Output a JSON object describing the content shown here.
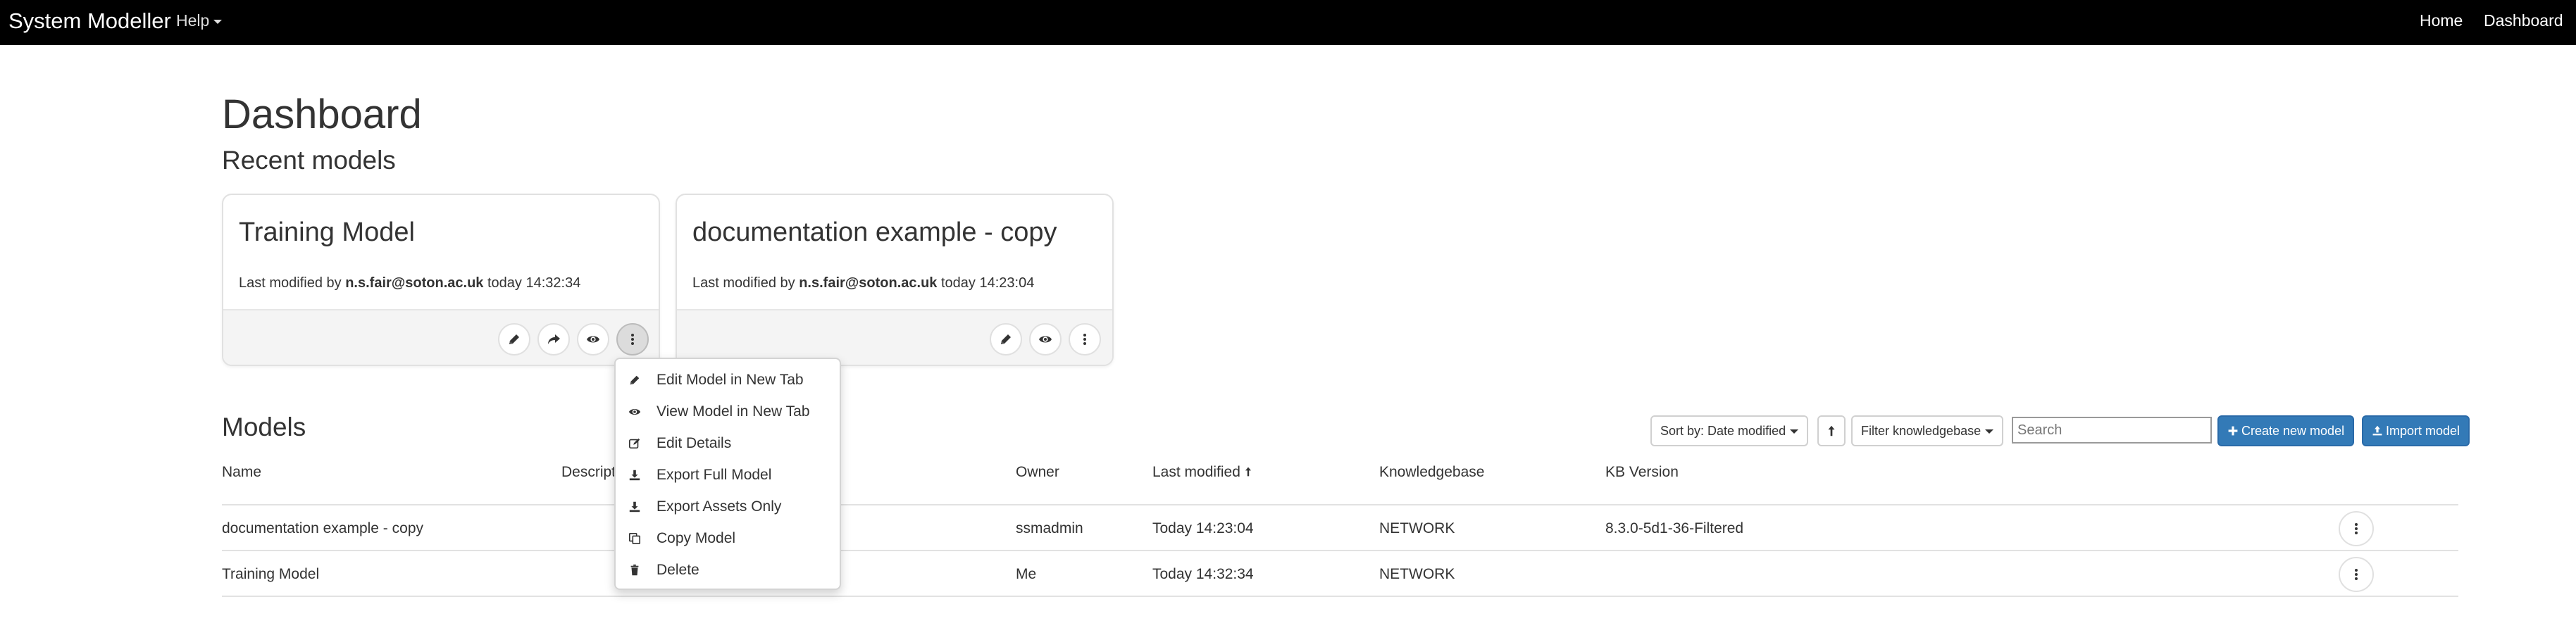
{
  "navbar": {
    "brand": "System Modeller",
    "help_label": "Help",
    "links": [
      "Home",
      "Dashboard"
    ],
    "background": "#000000"
  },
  "page": {
    "title": "Dashboard",
    "recent_heading": "Recent models",
    "models_heading": "Models"
  },
  "recent_models": [
    {
      "title": "Training Model",
      "meta_prefix": "Last modified by",
      "user": "n.s.fair@soton.ac.uk",
      "when": "today 14:32:34",
      "actions": [
        "pencil-icon",
        "share-icon",
        "eye-icon",
        "more-icon"
      ]
    },
    {
      "title": "documentation example - copy",
      "meta_prefix": "Last modified by",
      "user": "n.s.fair@soton.ac.uk",
      "when": "today 14:23:04",
      "actions": [
        "pencil-icon",
        "eye-icon",
        "more-icon"
      ]
    }
  ],
  "context_menu": {
    "items": [
      {
        "label": "Edit Model in New Tab",
        "icon": "pencil-icon"
      },
      {
        "label": "View Model in New Tab",
        "icon": "eye-icon"
      },
      {
        "label": "Edit Details",
        "icon": "edit-icon"
      },
      {
        "label": "Export Full Model",
        "icon": "download-icon"
      },
      {
        "label": "Export Assets Only",
        "icon": "download-icon"
      },
      {
        "label": "Copy Model",
        "icon": "copy-icon"
      },
      {
        "label": "Delete",
        "icon": "trash-icon"
      }
    ]
  },
  "toolbar": {
    "sort_label": "Sort by: Date modified",
    "sort_direction_icon": "arrow-up-icon",
    "filter_label": "Filter knowledgebase",
    "search_placeholder": "Search",
    "create_label": "Create new model",
    "import_label": "Import model",
    "primary_color": "#337ab7"
  },
  "table": {
    "headers": [
      "Name",
      "Description",
      "Owner",
      "Last modified",
      "Knowledgebase",
      "KB Version"
    ],
    "visible_description_header": "Descript",
    "rows": [
      {
        "name": "documentation example - copy",
        "owner": "ssmadmin",
        "modified": "Today 14:23:04",
        "kb": "NETWORK",
        "kb_version": "8.3.0-5d1-36-Filtered"
      },
      {
        "name": "Training Model",
        "owner": "Me",
        "modified": "Today 14:32:34",
        "kb": "NETWORK",
        "kb_version": ""
      }
    ]
  }
}
